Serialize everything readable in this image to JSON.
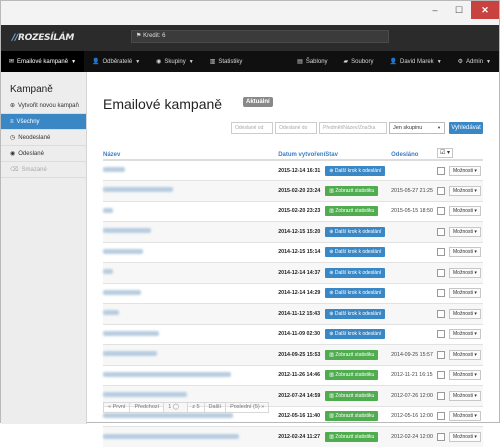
{
  "header": {
    "logo": "ROZESÍLÁM",
    "credit_label": "Kredit: 6"
  },
  "nav": {
    "left": [
      {
        "icon": "envelope-icon",
        "label": "Emailové kampaně",
        "active": true,
        "dropdown": true
      },
      {
        "icon": "users-icon",
        "label": "Odběratelé",
        "dropdown": true
      },
      {
        "icon": "group-icon",
        "label": "Skupiny",
        "dropdown": true
      },
      {
        "icon": "chart-icon",
        "label": "Statistiky",
        "dropdown": false
      }
    ],
    "right": [
      {
        "icon": "template-icon",
        "label": "Šablony"
      },
      {
        "icon": "folder-icon",
        "label": "Soubory"
      },
      {
        "icon": "user-icon",
        "label": "David Marek",
        "dropdown": true
      },
      {
        "icon": "gear-icon",
        "label": "Admin",
        "dropdown": true
      }
    ]
  },
  "sidebar": {
    "title": "Kampaně",
    "items": [
      {
        "icon": "plus-icon",
        "label": "Vytvořit novou kampaň"
      },
      {
        "icon": "list-icon",
        "label": "Všechny",
        "active": true
      },
      {
        "icon": "clock-icon",
        "label": "Neodeslané"
      },
      {
        "icon": "check-icon",
        "label": "Odeslané"
      },
      {
        "icon": "trash-icon",
        "label": "Smazané",
        "disabled": true
      }
    ]
  },
  "main": {
    "title": "Emailové kampaně",
    "badge": "Aktuální",
    "filters": {
      "date_from_placeholder": "Odeslané od",
      "date_to_placeholder": "Odeslané do",
      "subject_placeholder": "Předmět/Název/Značka",
      "group_select": "Jen skupinu",
      "search_button": "Vyhledávat"
    },
    "table": {
      "columns": [
        "Název",
        "Datum vytvoření",
        "Stav",
        "Odesláno"
      ],
      "more_label": "Možnosti",
      "rows": [
        {
          "date": "2015-12-14 16:31",
          "status": "Další krok k odeslání",
          "kind": "blue",
          "sent": ""
        },
        {
          "date": "2015-02-20 23:24",
          "status": "Zobrazit statistiku",
          "kind": "green",
          "sent": "2015-05-27 21:25"
        },
        {
          "date": "2015-02-20 23:23",
          "status": "Zobrazit statistiku",
          "kind": "green",
          "sent": "2015-05-15 18:50"
        },
        {
          "date": "2014-12-15 15:20",
          "status": "Další krok k odeslání",
          "kind": "blue",
          "sent": ""
        },
        {
          "date": "2014-12-15 15:14",
          "status": "Další krok k odeslání",
          "kind": "blue",
          "sent": ""
        },
        {
          "date": "2014-12-14 14:37",
          "status": "Další krok k odeslání",
          "kind": "blue",
          "sent": ""
        },
        {
          "date": "2014-12-14 14:29",
          "status": "Další krok k odeslání",
          "kind": "blue",
          "sent": ""
        },
        {
          "date": "2014-11-12 15:43",
          "status": "Další krok k odeslání",
          "kind": "blue",
          "sent": ""
        },
        {
          "date": "2014-11-09 02:30",
          "status": "Další krok k odeslání",
          "kind": "blue",
          "sent": ""
        },
        {
          "date": "2014-09-25 15:53",
          "status": "Zobrazit statistiku",
          "kind": "green",
          "sent": "2014-09-25 15:57"
        },
        {
          "date": "2012-11-26 14:46",
          "status": "Zobrazit statistiku",
          "kind": "green",
          "sent": "2012-11-21 16:15"
        },
        {
          "date": "2012-07-24 14:59",
          "status": "Zobrazit statistiku",
          "kind": "green",
          "sent": "2012-07-26 12:00"
        },
        {
          "date": "2012-05-16 11:40",
          "status": "Zobrazit statistiku",
          "kind": "green",
          "sent": "2012-05-16 12:00"
        },
        {
          "date": "2012-02-24 11:27",
          "status": "Zobrazit statistiku",
          "kind": "green",
          "sent": "2012-02-24 12:00"
        }
      ]
    },
    "pager": {
      "first": "« První",
      "prev": "Předchozí",
      "page": "1",
      "of": "z 5",
      "next": "Další",
      "last": "Poslední (5) »"
    }
  },
  "colors": {
    "accent": "#3a87c6",
    "success": "#4fac4f",
    "navbar": "#101010",
    "close": "#c8433f"
  }
}
